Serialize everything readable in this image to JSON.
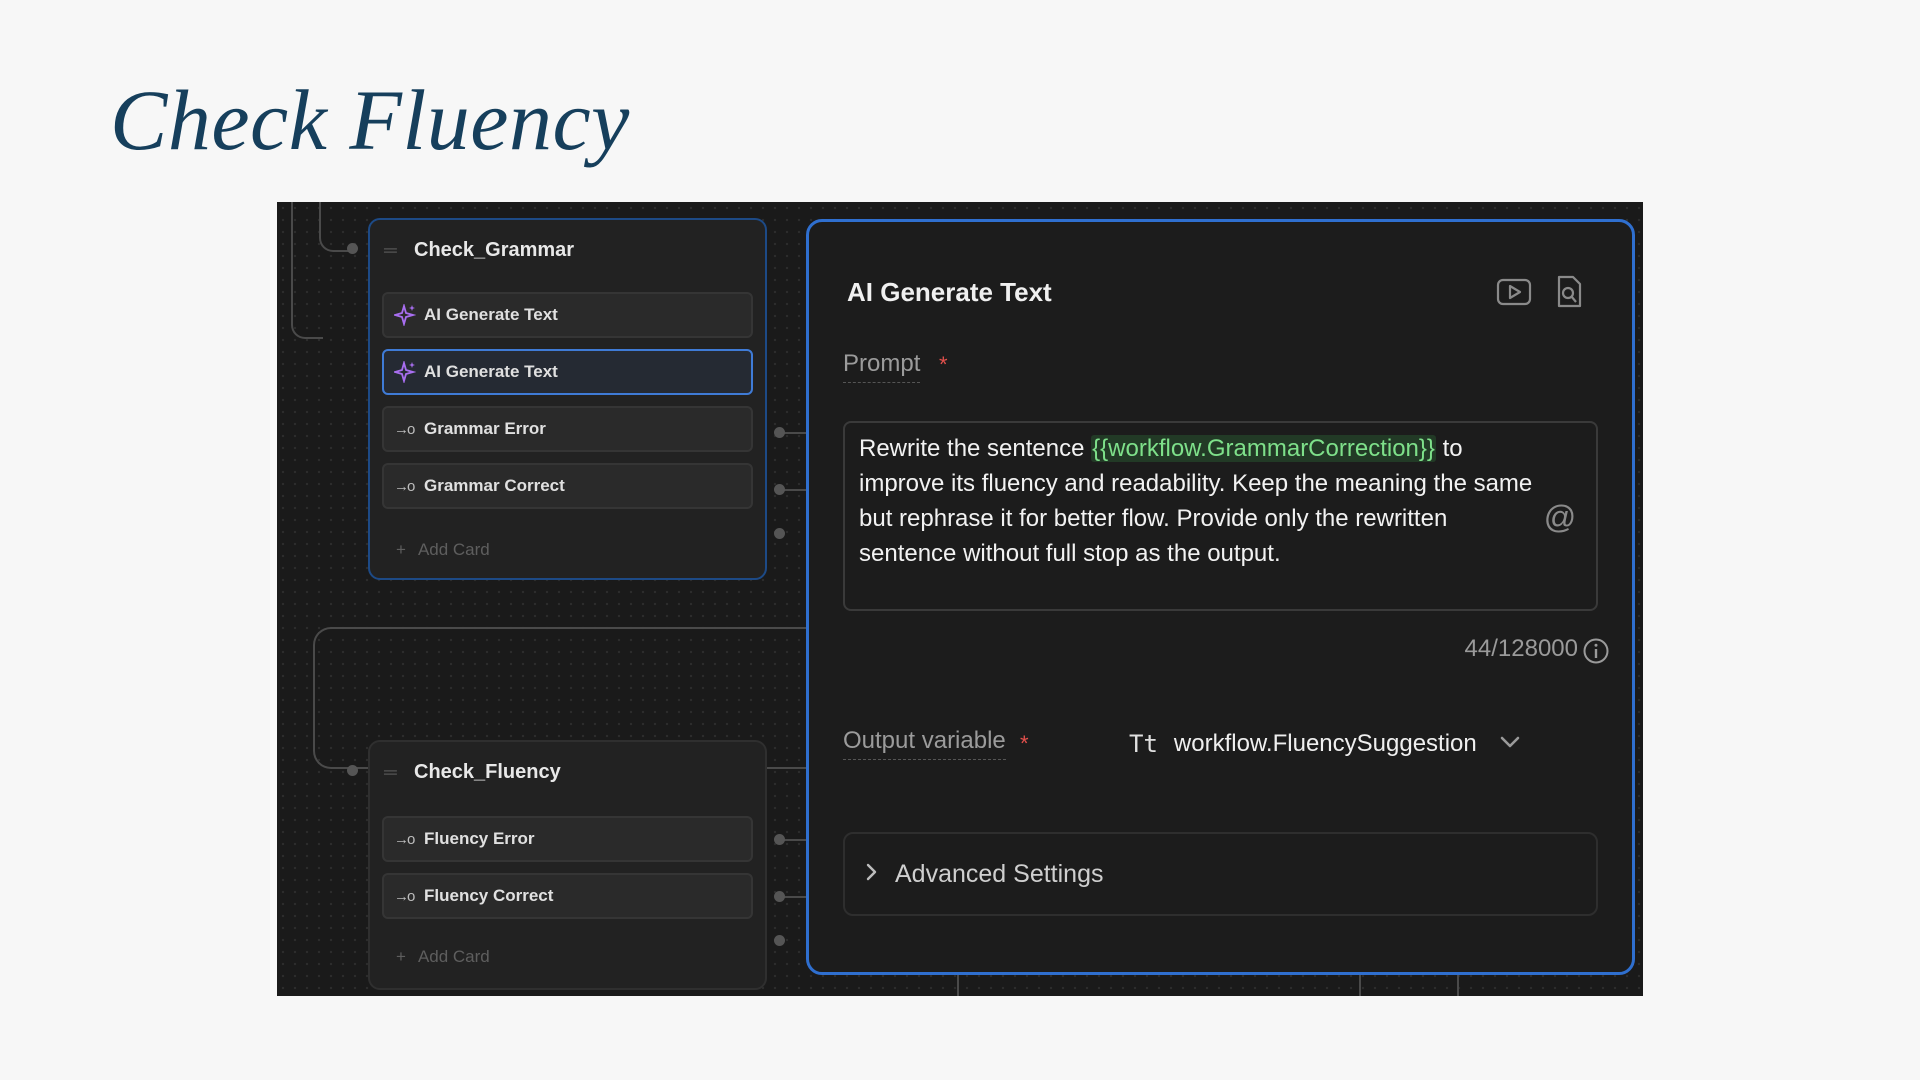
{
  "slide": {
    "title": "Check Fluency"
  },
  "nodes": {
    "grammar": {
      "name": "Check_Grammar",
      "cards": [
        {
          "label": "AI Generate Text",
          "icon": "sparkle-icon",
          "active": false
        },
        {
          "label": "AI Generate Text",
          "icon": "sparkle-icon",
          "active": true
        },
        {
          "label": "Grammar Error",
          "icon": "branch-arrow-icon",
          "active": false
        },
        {
          "label": "Grammar Correct",
          "icon": "branch-arrow-icon",
          "active": false
        }
      ],
      "add_card": "Add Card"
    },
    "fluency": {
      "name": "Check_Fluency",
      "cards": [
        {
          "label": "Fluency Error",
          "icon": "branch-arrow-icon"
        },
        {
          "label": "Fluency Correct",
          "icon": "branch-arrow-icon"
        }
      ],
      "add_card": "Add Card"
    }
  },
  "panel": {
    "title": "AI Generate Text",
    "prompt": {
      "label": "Prompt",
      "required_mark": "*",
      "text_before": "Rewrite the sentence ",
      "variable": "{{workflow.GrammarCorrection}}",
      "text_after": " to improve its fluency and readability. Keep the meaning the same but rephrase it for better flow. Provide only the rewritten sentence without full stop as the output.",
      "counter": "44/128000",
      "mention_symbol": "@"
    },
    "output": {
      "label": "Output variable",
      "required_mark": "*",
      "type_icon": "Tt",
      "value": "workflow.FluencySuggestion"
    },
    "advanced": {
      "label": "Advanced Settings"
    }
  },
  "colors": {
    "accent_blue": "#2f6fcf",
    "variable_green": "#7ee08a",
    "required_red": "#e2504c",
    "sparkle_purple": "#a86ef0",
    "title_navy": "#163f5c"
  }
}
